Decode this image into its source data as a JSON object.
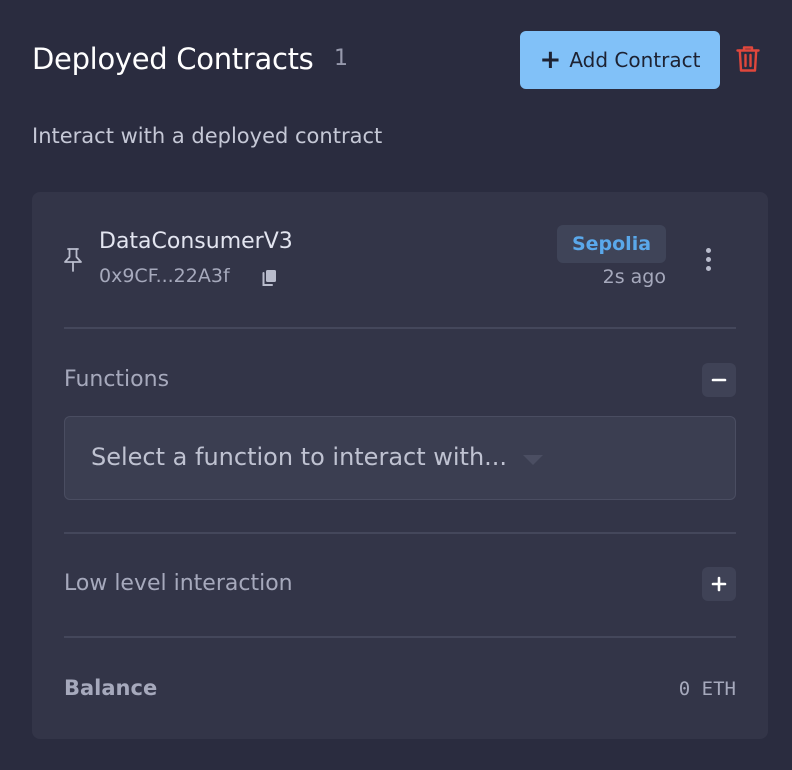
{
  "header": {
    "title": "Deployed Contracts",
    "count": "1",
    "add_button_label": "Add Contract",
    "add_button_color": "#81c1f8",
    "delete_icon": "trash-icon",
    "delete_icon_color": "#e0473c"
  },
  "subtitle": "Interact with a deployed contract",
  "contract": {
    "pin_icon": "pin-icon",
    "name": "DataConsumerV3",
    "address": "0x9CF...22A3f",
    "copy_icon": "copy-icon",
    "network": "Sepolia",
    "network_color": "#5aa8ea",
    "timestamp": "2s ago",
    "menu_icon": "kebab-menu-icon",
    "functions": {
      "label": "Functions",
      "toggle_icon": "minus-icon",
      "select_placeholder": "Select a function to interact with...",
      "caret_icon": "chevron-down-icon"
    },
    "low_level": {
      "label": "Low level interaction",
      "toggle_icon": "plus-icon"
    },
    "balance": {
      "label": "Balance",
      "value": "0 ETH"
    }
  }
}
